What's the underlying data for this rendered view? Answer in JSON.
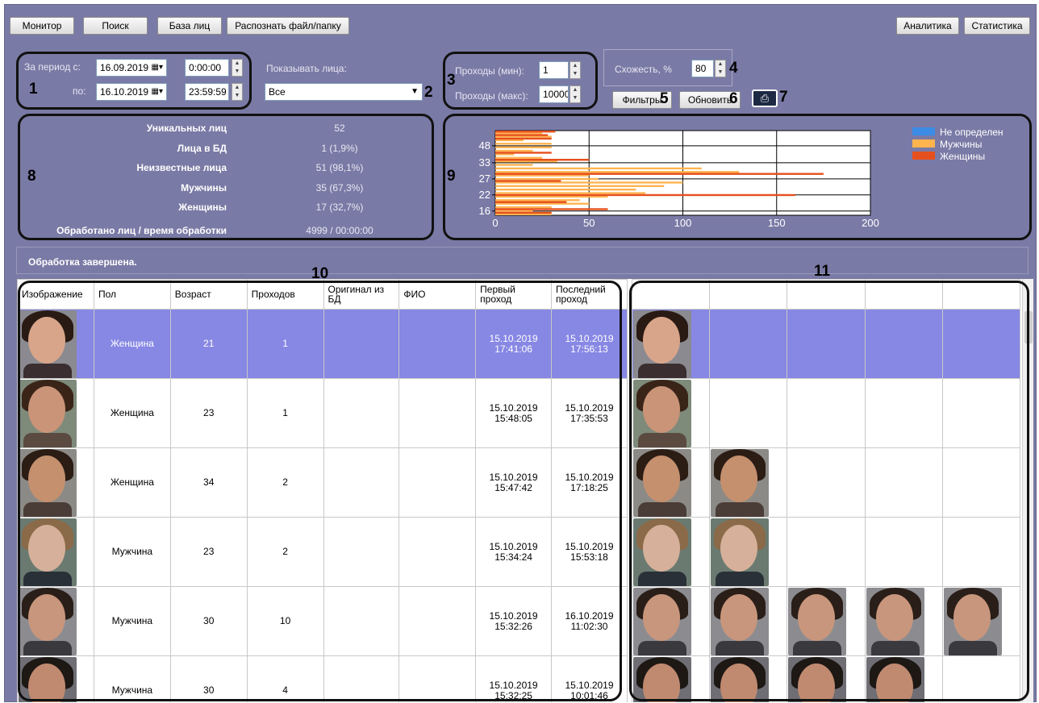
{
  "toolbar": {
    "monitor": "Монитор",
    "search": "Поиск",
    "facebase": "База лиц",
    "recognize": "Распознать файл/папку",
    "analytics": "Аналитика",
    "statistics": "Статистика"
  },
  "period": {
    "from_label": "За период с:",
    "to_label": "по:",
    "from_date": "16.09.2019",
    "from_time": "0:00:00",
    "to_date": "16.10.2019",
    "to_time": "23:59:59"
  },
  "show_faces": {
    "label": "Показывать лица:",
    "value": "Все"
  },
  "passes": {
    "min_label": "Проходы (мин):",
    "max_label": "Проходы (макс):",
    "min_value": "1",
    "max_value": "10000"
  },
  "similarity": {
    "label": "Схожесть, %",
    "value": "80"
  },
  "actions": {
    "filters": "Фильтры",
    "refresh": "Обновить"
  },
  "callouts": {
    "n1": "1",
    "n2": "2",
    "n3": "3",
    "n4": "4",
    "n5": "5",
    "n6": "6",
    "n7": "7",
    "n8": "8",
    "n9": "9",
    "n10": "10",
    "n11": "11"
  },
  "stats": [
    {
      "label": "Уникальных лиц",
      "value": "52"
    },
    {
      "label": "Лица в БД",
      "value": "1 (1,9%)"
    },
    {
      "label": "Неизвестные лица",
      "value": "51 (98,1%)"
    },
    {
      "label": "Мужчины",
      "value": "35 (67,3%)"
    },
    {
      "label": "Женщины",
      "value": "17 (32,7%)"
    },
    {
      "label": "Обработано лиц / время обработки",
      "value": "4999 / 00:00:00"
    }
  ],
  "status": "Обработка завершена.",
  "table": {
    "headers": [
      "Изображение",
      "Пол",
      "Возраст",
      "Проходов",
      "Оригинал из БД",
      "ФИО",
      "Первый проход",
      "Последний проход"
    ],
    "rows": [
      {
        "gender": "Женщина",
        "age": "21",
        "passes": "1",
        "first_date": "15.10.2019",
        "first_time": "17:41:06",
        "last_date": "15.10.2019",
        "last_time": "17:56:13"
      },
      {
        "gender": "Женщина",
        "age": "23",
        "passes": "1",
        "first_date": "15.10.2019",
        "first_time": "15:48:05",
        "last_date": "15.10.2019",
        "last_time": "17:35:53"
      },
      {
        "gender": "Женщина",
        "age": "34",
        "passes": "2",
        "first_date": "15.10.2019",
        "first_time": "15:47:42",
        "last_date": "15.10.2019",
        "last_time": "17:18:25"
      },
      {
        "gender": "Мужчина",
        "age": "23",
        "passes": "2",
        "first_date": "15.10.2019",
        "first_time": "15:34:24",
        "last_date": "15.10.2019",
        "last_time": "15:53:18"
      },
      {
        "gender": "Мужчина",
        "age": "30",
        "passes": "10",
        "first_date": "15.10.2019",
        "first_time": "15:32:26",
        "last_date": "16.10.2019",
        "last_time": "11:02:30"
      },
      {
        "gender": "Мужчина",
        "age": "30",
        "passes": "4",
        "first_date": "15.10.2019",
        "first_time": "15:32:25",
        "last_date": "15.10.2019",
        "last_time": "10:01:46"
      }
    ]
  },
  "chart_data": {
    "type": "bar",
    "orientation": "horizontal",
    "y_ticks": [
      "48",
      "33",
      "27",
      "22",
      "16"
    ],
    "x_ticks": [
      "0",
      "50",
      "100",
      "150",
      "200"
    ],
    "xlim": [
      0,
      200
    ],
    "legend": [
      "Не определен",
      "Мужчины",
      "Женщины"
    ],
    "legend_colors": [
      "#3c8ce6",
      "#ffb450",
      "#e6501e"
    ],
    "series": [
      {
        "name": "Мужчины",
        "color": "#ffb450",
        "values": [
          25,
          30,
          15,
          30,
          30,
          20,
          10,
          25,
          33,
          20,
          110,
          130,
          50,
          55,
          100,
          90,
          75,
          80,
          60,
          45,
          50,
          30,
          20,
          30
        ]
      },
      {
        "name": "Женщины",
        "color": "#e6501e",
        "values": [
          32,
          28,
          30,
          0,
          0,
          0,
          30,
          0,
          50,
          0,
          0,
          0,
          175,
          0,
          35,
          0,
          0,
          0,
          160,
          0,
          38,
          0,
          60,
          30
        ]
      }
    ]
  }
}
